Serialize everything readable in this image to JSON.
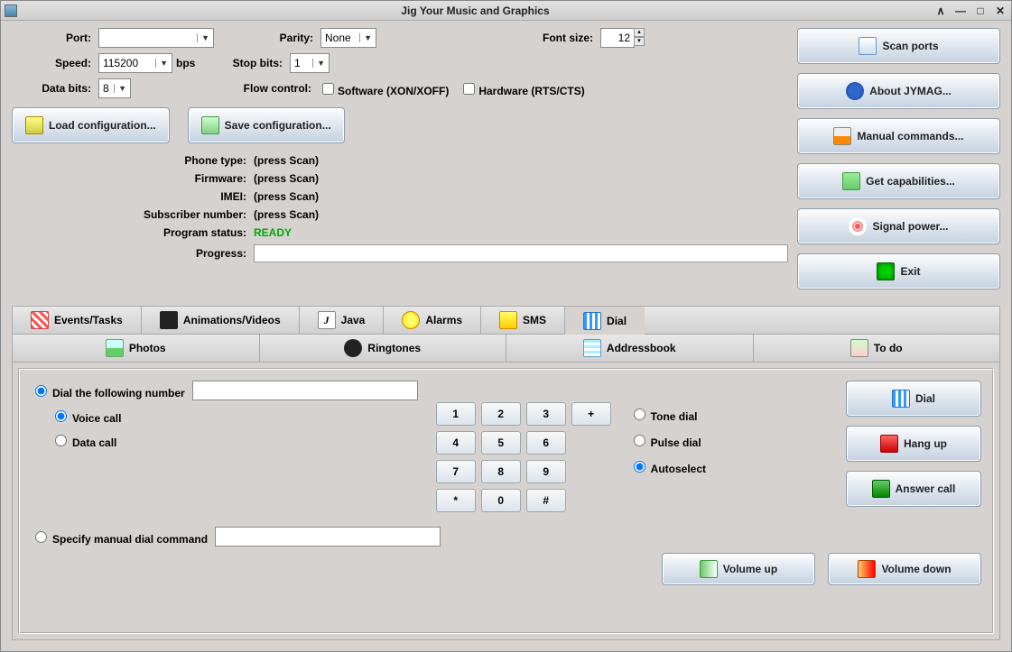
{
  "title": "Jig Your Music and Graphics",
  "port": {
    "label": "Port:",
    "value": "",
    "speed_label": "Speed:",
    "speed": "115200",
    "bps": "bps",
    "databits_label": "Data bits:",
    "databits": "8",
    "parity_label": "Parity:",
    "parity": "None",
    "stopbits_label": "Stop bits:",
    "stopbits": "1",
    "flow_label": "Flow control:",
    "sw": "Software (XON/XOFF)",
    "hw": "Hardware (RTS/CTS)",
    "fontsize_label": "Font size:",
    "fontsize": "12"
  },
  "cfg": {
    "load": "Load configuration...",
    "save": "Save configuration..."
  },
  "info": {
    "phone_l": "Phone type:",
    "phone_v": "(press Scan)",
    "fw_l": "Firmware:",
    "fw_v": "(press Scan)",
    "imei_l": "IMEI:",
    "imei_v": "(press Scan)",
    "sub_l": "Subscriber number:",
    "sub_v": "(press Scan)",
    "stat_l": "Program status:",
    "stat_v": "READY",
    "prog_l": "Progress:"
  },
  "side": {
    "scan": "Scan ports",
    "about": "About JYMAG...",
    "manual": "Manual commands...",
    "cap": "Get capabilities...",
    "sig": "Signal power...",
    "exit": "Exit"
  },
  "tabs1": {
    "ev": "Events/Tasks",
    "anim": "Animations/Videos",
    "java": "Java",
    "alarm": "Alarms",
    "sms": "SMS",
    "dial": "Dial"
  },
  "tabs2": {
    "photos": "Photos",
    "ring": "Ringtones",
    "addr": "Addressbook",
    "todo": "To do"
  },
  "dial": {
    "r1": "Dial the following number",
    "voice": "Voice call",
    "data": "Data call",
    "tone": "Tone dial",
    "pulse": "Pulse dial",
    "auto": "Autoselect",
    "manual": "Specify manual dial command",
    "dial_btn": "Dial",
    "hang": "Hang up",
    "ans": "Answer call",
    "vup": "Volume up",
    "vdn": "Volume down",
    "k": [
      "1",
      "2",
      "3",
      "+",
      "4",
      "5",
      "6",
      "",
      "7",
      "8",
      "9",
      "",
      "*",
      "0",
      "#",
      ""
    ]
  }
}
